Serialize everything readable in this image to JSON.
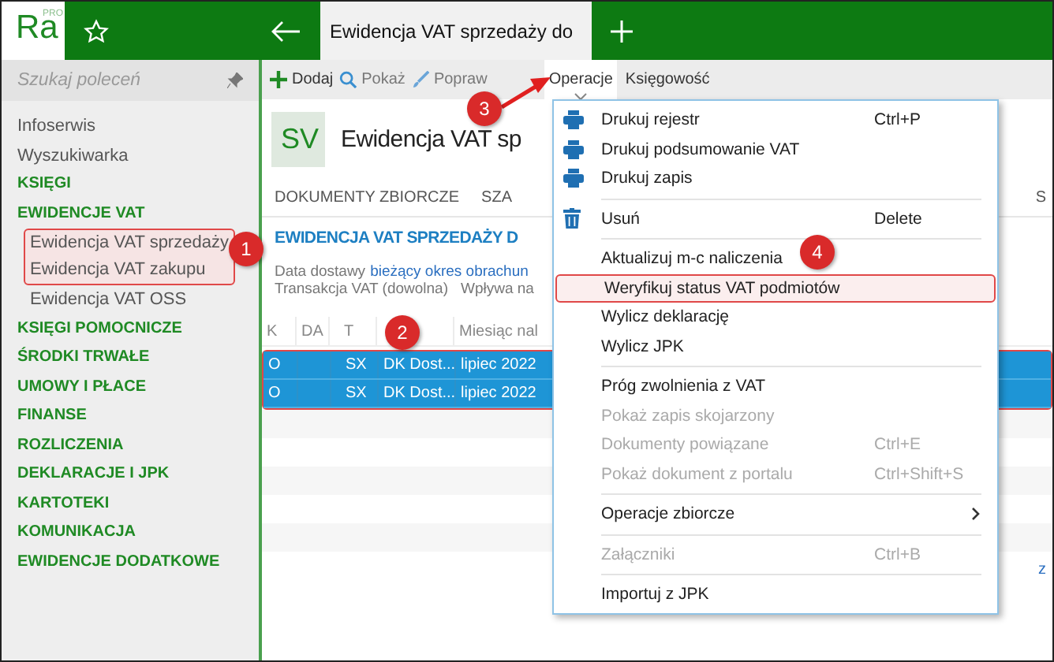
{
  "app": {
    "logo": "Ra",
    "logo_sup": "PRO"
  },
  "tabs": [
    {
      "label": "Ewidencja VAT sprzedaży do",
      "selected": true
    }
  ],
  "sidebar": {
    "search": {
      "placeholder": "Szukaj poleceń"
    },
    "items": [
      {
        "label": "Infoserwis",
        "kind": "link"
      },
      {
        "label": "Wyszukiwarka",
        "kind": "link"
      },
      {
        "label": "KSIĘGI",
        "kind": "section"
      },
      {
        "label": "EWIDENCJE VAT",
        "kind": "section"
      },
      {
        "label": "Ewidencja VAT sprzedaży",
        "kind": "sub"
      },
      {
        "label": "Ewidencja VAT zakupu",
        "kind": "sub"
      },
      {
        "label": "Ewidencja VAT OSS",
        "kind": "sub"
      },
      {
        "label": "KSIĘGI POMOCNICZE",
        "kind": "section"
      },
      {
        "label": "ŚRODKI TRWAŁE",
        "kind": "section"
      },
      {
        "label": "UMOWY I PŁACE",
        "kind": "section"
      },
      {
        "label": "FINANSE",
        "kind": "section"
      },
      {
        "label": "ROZLICZENIA",
        "kind": "section"
      },
      {
        "label": "DEKLARACJE I JPK",
        "kind": "section"
      },
      {
        "label": "KARTOTEKI",
        "kind": "section"
      },
      {
        "label": "KOMUNIKACJA",
        "kind": "section"
      },
      {
        "label": "EWIDENCJE DODATKOWE",
        "kind": "section"
      }
    ]
  },
  "toolbar": [
    {
      "label": "Dodaj",
      "kind": "add",
      "selected": false
    },
    {
      "label": "Pokaż",
      "kind": "view",
      "selected": false
    },
    {
      "label": "Popraw",
      "kind": "edit",
      "selected": false
    },
    {
      "label": "Operacje",
      "kind": "dropdown",
      "selected": true
    },
    {
      "label": "Księgowość",
      "kind": "dropdown",
      "selected": false
    }
  ],
  "page": {
    "badge": "SV",
    "title": "Ewidencja VAT sp",
    "section_tabs": [
      "DOKUMENTY ZBIORCZE",
      "SZA"
    ],
    "section_tab_right": "S",
    "heading": "EWIDENCJA VAT SPRZEDAŻY D",
    "filter_1": {
      "label": "Data dostawy",
      "link": "bieżący okres obrachun"
    },
    "filter_2": [
      "Transakcja VAT (dowolna)",
      "Wpływa na"
    ],
    "footer_cut": "z"
  },
  "table": {
    "columns": [
      "K",
      "DA",
      "T",
      "",
      "Miesiąc nal"
    ],
    "rows": [
      {
        "cells": [
          "O",
          "",
          "SX",
          "DK Dost...",
          "lipiec 2022"
        ],
        "selected": true
      },
      {
        "cells": [
          "O",
          "",
          "SX",
          "DK Dost...",
          "lipiec 2022"
        ],
        "selected": true
      }
    ]
  },
  "menu": [
    {
      "kind": "print",
      "label": "Drukuj rejestr",
      "shortcut": "Ctrl+P",
      "disabled": false
    },
    {
      "kind": "print",
      "label": "Drukuj podsumowanie VAT",
      "disabled": false
    },
    {
      "kind": "print",
      "label": "Drukuj zapis",
      "disabled": false
    },
    {
      "kind": "separator"
    },
    {
      "kind": "delete",
      "label": "Usuń",
      "shortcut": "Delete",
      "disabled": false
    },
    {
      "kind": "separator"
    },
    {
      "kind": "plain",
      "label": "Aktualizuj m-c naliczenia",
      "disabled": false
    },
    {
      "kind": "plain",
      "label": "Weryfikuj status VAT podmiotów",
      "disabled": false
    },
    {
      "kind": "plain",
      "label": "Wylicz deklarację",
      "disabled": false
    },
    {
      "kind": "plain",
      "label": "Wylicz JPK",
      "disabled": false
    },
    {
      "kind": "separator"
    },
    {
      "kind": "plain",
      "label": "Próg zwolnienia z VAT",
      "disabled": false
    },
    {
      "kind": "plain",
      "label": "Pokaż zapis skojarzony",
      "disabled": true
    },
    {
      "kind": "plain",
      "label": "Dokumenty powiązane",
      "shortcut": "Ctrl+E",
      "disabled": true
    },
    {
      "kind": "plain",
      "label": "Pokaż dokument z portalu",
      "shortcut": "Ctrl+Shift+S",
      "disabled": true
    },
    {
      "kind": "separator"
    },
    {
      "kind": "plain",
      "label": "Operacje zbiorcze",
      "submenu": true,
      "disabled": false
    },
    {
      "kind": "separator"
    },
    {
      "kind": "plain",
      "label": "Załączniki",
      "shortcut": "Ctrl+B",
      "disabled": true
    },
    {
      "kind": "separator"
    },
    {
      "kind": "plain",
      "label": "Importuj z JPK",
      "disabled": false
    }
  ],
  "annotations": [
    {
      "number": "1"
    },
    {
      "number": "2"
    },
    {
      "number": "3"
    },
    {
      "number": "4"
    }
  ]
}
